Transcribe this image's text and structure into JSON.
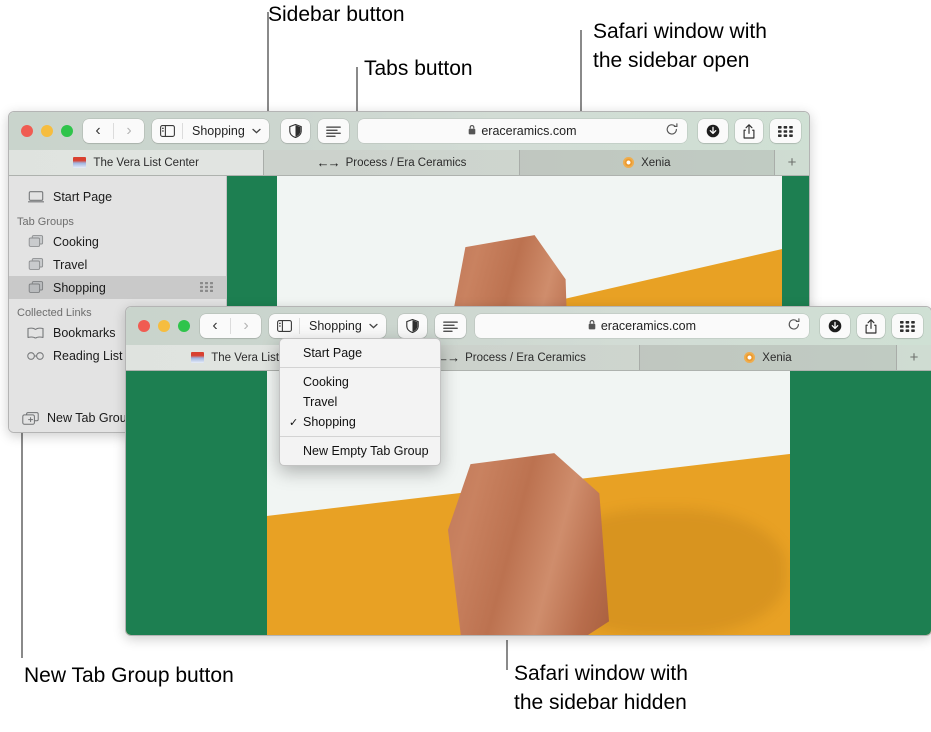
{
  "callouts": [
    {
      "key": "sidebar_button",
      "text": "Sidebar button"
    },
    {
      "key": "tabs_button",
      "text": "Tabs button"
    },
    {
      "key": "window_open",
      "text": "Safari window with\nthe sidebar open"
    },
    {
      "key": "new_tab_group",
      "text": "New Tab Group button"
    },
    {
      "key": "window_hidden",
      "text": "Safari window with\nthe sidebar hidden"
    }
  ],
  "window_open": {
    "traffic": {
      "close": "close-button",
      "minimize": "minimize-button",
      "zoom": "zoom-button"
    },
    "nav": {
      "back": "‹",
      "forward": "›"
    },
    "sidebar_icon": "sidebar-icon",
    "tab_group_name": "Shopping",
    "chevron": "⌄",
    "reader_icon": "reader-icon",
    "privacy_icon": "privacy-report-icon",
    "url": "eraceramics.com",
    "lock": "🔒",
    "reload": "↻",
    "download_icon": "download-icon",
    "share_icon": "share-icon",
    "tab_overview_icon": "tab-overview-icon",
    "tabs": [
      {
        "title": "The Vera List Center",
        "favicon": "vera-gradient-favicon",
        "state": "active"
      },
      {
        "title": "Process / Era Ceramics",
        "favicon": "arrows-favicon",
        "state": "inactive"
      },
      {
        "title": "Xenia",
        "favicon": "sun-favicon",
        "state": "selected"
      }
    ],
    "new_tab_label": "+",
    "sidebar": {
      "start_page": {
        "label": "Start Page",
        "icon": "start-page-icon"
      },
      "tab_groups_header": "Tab Groups",
      "tab_groups": [
        {
          "label": "Cooking",
          "icon": "tab-group-icon",
          "selected": false
        },
        {
          "label": "Travel",
          "icon": "tab-group-icon",
          "selected": false
        },
        {
          "label": "Shopping",
          "icon": "tab-group-icon",
          "selected": true
        }
      ],
      "collected_links_header": "Collected Links",
      "collected_links": [
        {
          "label": "Bookmarks",
          "icon": "book-icon"
        },
        {
          "label": "Reading List",
          "icon": "glasses-icon"
        }
      ],
      "new_tab_group_label": "New Tab Group",
      "new_tab_group_icon": "new-tab-group-icon"
    }
  },
  "window_hidden": {
    "nav": {
      "back": "‹",
      "forward": "›"
    },
    "sidebar_icon": "sidebar-icon",
    "tab_group_name": "Shopping",
    "chevron": "⌄",
    "reader_icon": "reader-icon",
    "privacy_icon": "privacy-report-icon",
    "url": "eraceramics.com",
    "lock": "🔒",
    "reload": "↻",
    "download_icon": "download-icon",
    "share_icon": "share-icon",
    "tab_overview_icon": "tab-overview-icon",
    "tabs": [
      {
        "title": "The Vera List Center",
        "favicon": "vera-gradient-favicon",
        "state": "active"
      },
      {
        "title": "Process / Era Ceramics",
        "favicon": "arrows-favicon",
        "state": "inactive"
      },
      {
        "title": "Xenia",
        "favicon": "sun-favicon",
        "state": "selected"
      }
    ],
    "new_tab_label": "+",
    "menu": {
      "items": [
        {
          "label": "Start Page",
          "checked": false
        },
        {
          "label": "Cooking",
          "checked": false
        },
        {
          "label": "Travel",
          "checked": false
        },
        {
          "label": "Shopping",
          "checked": true
        },
        {
          "label": "New Empty Tab Group",
          "checked": false
        }
      ],
      "check_glyph": "✓"
    }
  },
  "colors": {
    "photo_green": "#1d7f51",
    "photo_orange": "#e8a124",
    "photo_wall": "#f1f5f3",
    "clay": "#c07d5c",
    "toolbar": "#ccd6cf",
    "sidebar_bg": "#e3e3e3",
    "sidebar_selected": "#c9c9c9",
    "leader_line": "#8a8a8a"
  }
}
